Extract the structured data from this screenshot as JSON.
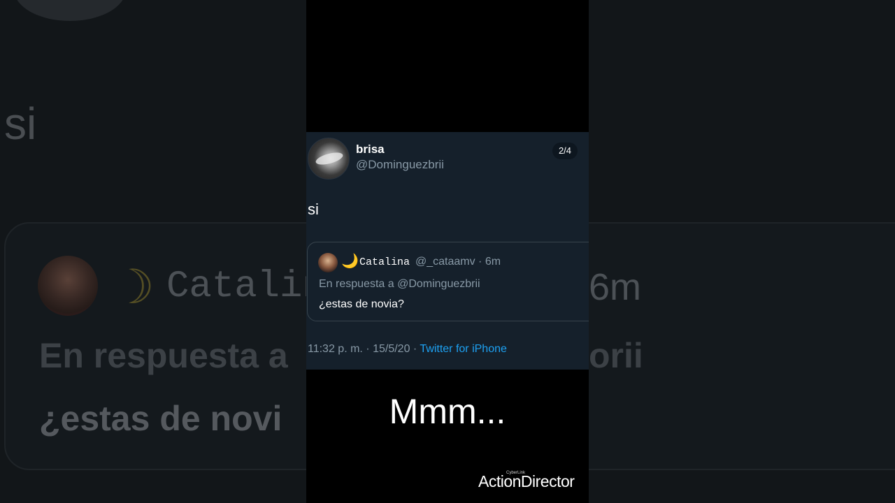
{
  "background_echo": {
    "si": "si",
    "name": "Catalin",
    "time": "6m",
    "reply_prefix": "En respuesta a",
    "reply_suffix": "orii",
    "question": "¿estas de novi"
  },
  "tweet": {
    "display_name": "brisa",
    "handle": "@Dominguezbrii",
    "counter": "2/4",
    "text": "si",
    "quoted": {
      "moon": "🌙",
      "name": "Catalina",
      "meta": "@_cataamv · 6m",
      "reply_to": "En respuesta a @Dominguezbrii",
      "text": "¿estas de novia?"
    },
    "timestamp": "11:32 p. m. · 15/5/20 · ",
    "source": "Twitter for iPhone"
  },
  "caption": "Mmm...",
  "watermark": {
    "brand": "ActionDirector",
    "small": "CyberLink"
  },
  "colors": {
    "tweet_bg": "#15202b",
    "link_blue": "#1da1f2",
    "muted_text": "#8899a6"
  }
}
